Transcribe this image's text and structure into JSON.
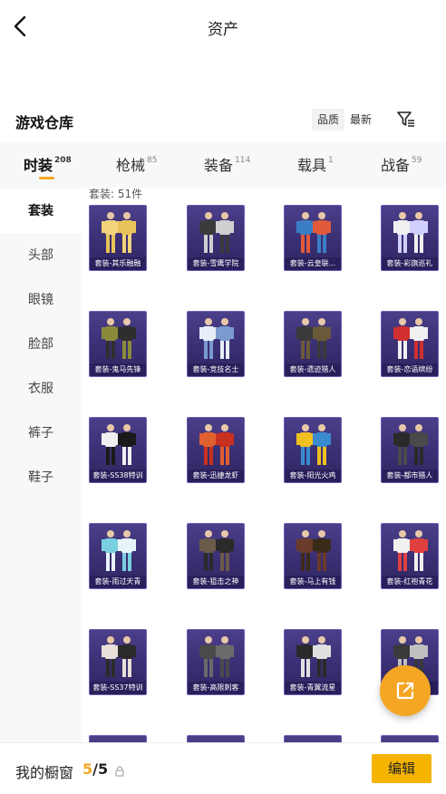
{
  "header": {
    "title": "资产"
  },
  "section": {
    "title": "游戏仓库",
    "sort_options": [
      "品质",
      "最新"
    ]
  },
  "tabs": [
    {
      "label": "时装",
      "count": "208"
    },
    {
      "label": "枪械",
      "count": "85"
    },
    {
      "label": "装备",
      "count": "114"
    },
    {
      "label": "载具",
      "count": "1"
    },
    {
      "label": "战备",
      "count": "59"
    }
  ],
  "sidebar": {
    "items": [
      "套装",
      "头部",
      "眼镜",
      "脸部",
      "衣服",
      "裤子",
      "鞋子"
    ]
  },
  "content": {
    "count_label": "套装: 51件",
    "items": [
      {
        "name": "套装-其乐融融",
        "colors": [
          "#f2d27a",
          "#e8c25a"
        ]
      },
      {
        "name": "套装-雪鹰学院",
        "colors": [
          "#3a3a3a",
          "#cfcfcf"
        ]
      },
      {
        "name": "套装-云皇联...",
        "colors": [
          "#3b7dc4",
          "#e05a3a"
        ]
      },
      {
        "name": "套装-彩旗巡礼",
        "colors": [
          "#f0f0f0",
          "#d0d0ff"
        ]
      },
      {
        "name": "套装-鬼马先锋",
        "colors": [
          "#8a8a3a",
          "#2e2e2e"
        ]
      },
      {
        "name": "套装-竞技名士",
        "colors": [
          "#e8eef8",
          "#7a9ad0"
        ]
      },
      {
        "name": "套装-遗迹猎人",
        "colors": [
          "#3a3a3a",
          "#6a5a3a"
        ]
      },
      {
        "name": "套装-恋语缤纷",
        "colors": [
          "#d03030",
          "#f0f0f0"
        ]
      },
      {
        "name": "套装-SS38特训",
        "colors": [
          "#f0f0f0",
          "#1a1a1a"
        ]
      },
      {
        "name": "套装-迅捷龙虾",
        "colors": [
          "#e06030",
          "#c83020"
        ]
      },
      {
        "name": "套装-阳光火鸡",
        "colors": [
          "#f0c020",
          "#3a8ad0"
        ]
      },
      {
        "name": "套装-都市猎人",
        "colors": [
          "#2a2a2a",
          "#4a4a4a"
        ]
      },
      {
        "name": "套装-雨过天青",
        "colors": [
          "#7ad0e0",
          "#e8f4f8"
        ]
      },
      {
        "name": "套装-狙击之神",
        "colors": [
          "#6a5a4a",
          "#2a2a2a"
        ]
      },
      {
        "name": "套装-马上有钱",
        "colors": [
          "#6a3a2a",
          "#3a2a1a"
        ]
      },
      {
        "name": "套装-红袍青花",
        "colors": [
          "#f0f0f0",
          "#e04040"
        ]
      },
      {
        "name": "套装-SS37特训",
        "colors": [
          "#e8e0d8",
          "#2a2a2a"
        ]
      },
      {
        "name": "套装-高限刺客",
        "colors": [
          "#4a4a4a",
          "#6a6a6a"
        ]
      },
      {
        "name": "套装-青翼流星",
        "colors": [
          "#2a2a2a",
          "#e0e0e0"
        ]
      },
      {
        "name": "套装-...",
        "colors": [
          "#3a3a3a",
          "#c0c0c0"
        ]
      }
    ]
  },
  "share_button": {
    "icon": "share-icon",
    "color": "#f5a623"
  },
  "bottom": {
    "label": "我的橱窗",
    "current": "5",
    "total": "/5",
    "edit_label": "编辑"
  },
  "colors": {
    "accent": "#f5a623",
    "tile_bg": "#3a2f73",
    "edit_btn": "#f5b400"
  }
}
